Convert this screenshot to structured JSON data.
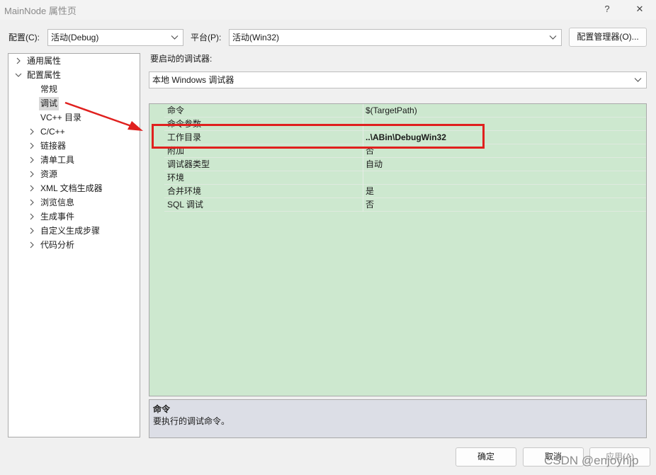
{
  "window": {
    "title": "MainNode 属性页",
    "help_glyph": "?",
    "close_glyph": "✕"
  },
  "config_row": {
    "config_label": "配置(C):",
    "config_value": "活动(Debug)",
    "platform_label": "平台(P):",
    "platform_value": "活动(Win32)",
    "manager_button": "配置管理器(O)..."
  },
  "tree": {
    "items": [
      {
        "label": "通用属性",
        "expander": "collapsed"
      },
      {
        "label": "配置属性",
        "expander": "expanded"
      },
      {
        "label": "常规",
        "expander": "none"
      },
      {
        "label": "调试",
        "expander": "none",
        "selected": true
      },
      {
        "label": "VC++ 目录",
        "expander": "none"
      },
      {
        "label": "C/C++",
        "expander": "collapsed"
      },
      {
        "label": "链接器",
        "expander": "collapsed"
      },
      {
        "label": "清单工具",
        "expander": "collapsed"
      },
      {
        "label": "资源",
        "expander": "collapsed"
      },
      {
        "label": "XML 文档生成器",
        "expander": "collapsed"
      },
      {
        "label": "浏览信息",
        "expander": "collapsed"
      },
      {
        "label": "生成事件",
        "expander": "collapsed"
      },
      {
        "label": "自定义生成步骤",
        "expander": "collapsed"
      },
      {
        "label": "代码分析",
        "expander": "collapsed"
      }
    ]
  },
  "debugger": {
    "label": "要启动的调试器:",
    "value": "本地 Windows 调试器"
  },
  "properties": [
    {
      "name": "命令",
      "value": "$(TargetPath)"
    },
    {
      "name": "命令参数",
      "value": ""
    },
    {
      "name": "工作目录",
      "value": "..\\ABin\\DebugWin32",
      "bold": true
    },
    {
      "name": "附加",
      "value": "否"
    },
    {
      "name": "调试器类型",
      "value": "自动"
    },
    {
      "name": "环境",
      "value": ""
    },
    {
      "name": "合并环境",
      "value": "是"
    },
    {
      "name": "SQL 调试",
      "value": "否"
    }
  ],
  "description": {
    "title": "命令",
    "text": "要执行的调试命令。"
  },
  "buttons": {
    "ok": "确定",
    "cancel": "取消",
    "apply": "应用(A)"
  },
  "watermark": "CSDN @enjoyhjp",
  "colors": {
    "grid_bg": "#cde8cf",
    "highlight": "#e0201e",
    "arrow": "#e0201e",
    "desc_bg": "#dcdee6"
  }
}
